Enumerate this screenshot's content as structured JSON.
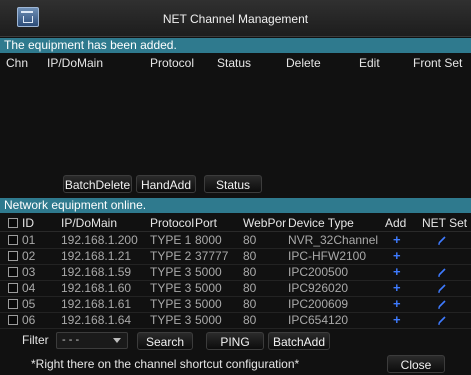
{
  "window": {
    "title": "NET Channel Management"
  },
  "added_section": {
    "banner": "The equipment has been added.",
    "columns": [
      "Chn",
      "IP/DoMain",
      "Protocol",
      "Status",
      "Delete",
      "Edit",
      "Front Set"
    ],
    "rows": []
  },
  "added_buttons": {
    "batch_delete": "BatchDelete",
    "hand_add": "HandAdd",
    "status": "Status"
  },
  "online_section": {
    "banner": "Network equipment online.",
    "columns": [
      "ID",
      "IP/DoMain",
      "Protocol",
      "Port",
      "WebPor",
      "Device Type",
      "Add",
      "NET Set"
    ],
    "rows": [
      {
        "id": "01",
        "ip": "192.168.1.200",
        "protocol": "TYPE 1",
        "port": "8000",
        "web_port": "80",
        "device_type": "NVR_32Channel",
        "add": "+",
        "net_set": "edit-icon"
      },
      {
        "id": "02",
        "ip": "192.168.1.21",
        "protocol": "TYPE 2",
        "port": "37777",
        "web_port": "80",
        "device_type": "IPC-HFW2100",
        "add": "+",
        "net_set": ""
      },
      {
        "id": "03",
        "ip": "192.168.1.59",
        "protocol": "TYPE 3",
        "port": "5000",
        "web_port": "80",
        "device_type": "IPC200500",
        "add": "+",
        "net_set": "edit-icon"
      },
      {
        "id": "04",
        "ip": "192.168.1.60",
        "protocol": "TYPE 3",
        "port": "5000",
        "web_port": "80",
        "device_type": "IPC926020",
        "add": "+",
        "net_set": "edit-icon"
      },
      {
        "id": "05",
        "ip": "192.168.1.61",
        "protocol": "TYPE 3",
        "port": "5000",
        "web_port": "80",
        "device_type": "IPC200609",
        "add": "+",
        "net_set": "edit-icon"
      },
      {
        "id": "06",
        "ip": "192.168.1.64",
        "protocol": "TYPE 3",
        "port": "5000",
        "web_port": "80",
        "device_type": "IPC654120",
        "add": "+",
        "net_set": "edit-icon"
      }
    ]
  },
  "filter": {
    "label": "Filter",
    "value": "- - -"
  },
  "filter_buttons": {
    "search": "Search",
    "ping": "PING",
    "batch_add": "BatchAdd"
  },
  "footer": {
    "hint": "*Right there on the channel shortcut configuration*",
    "close": "Close"
  },
  "colors": {
    "banner": "#2f7a8e",
    "accent_blue": "#3e7bff",
    "background": "#111111"
  }
}
